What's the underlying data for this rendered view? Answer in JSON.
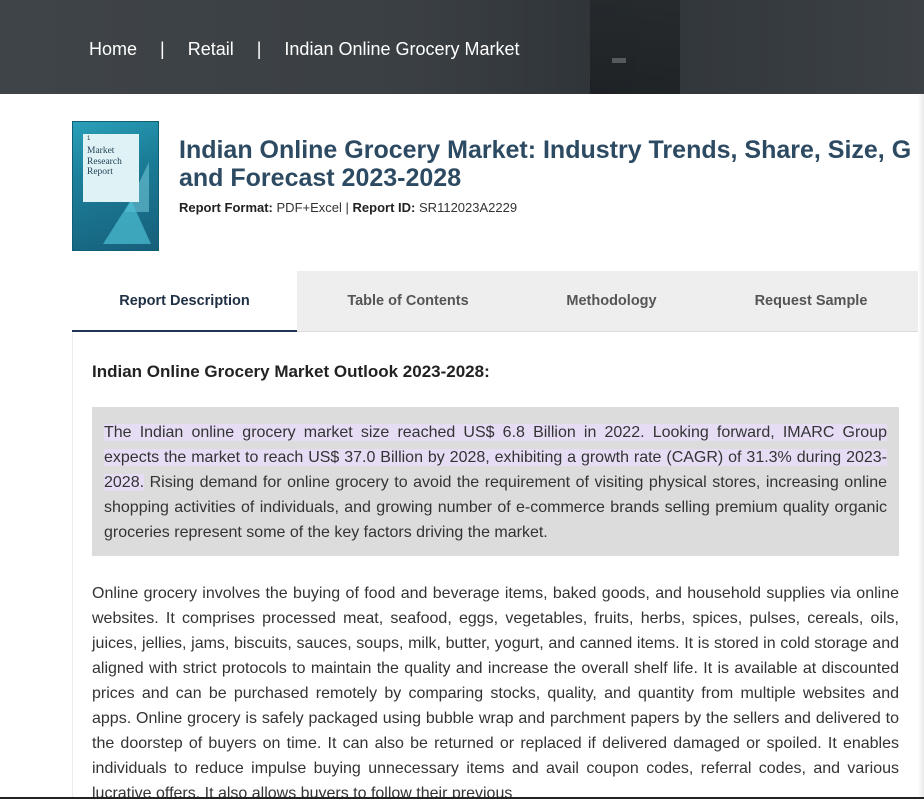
{
  "breadcrumb": {
    "items": [
      "Home",
      "Retail",
      "Indian Online Grocery Market"
    ],
    "separator": "|"
  },
  "cover": {
    "number": "1",
    "lines": [
      "Market",
      "Research",
      "Report"
    ]
  },
  "report": {
    "title_line1": "Indian Online Grocery Market: Industry Trends, Share, Size, G",
    "title_line2": "and Forecast 2023-2028",
    "format_label": "Report Format:",
    "format_value": "PDF+Excel",
    "meta_sep": "|",
    "id_label": "Report ID:",
    "id_value": "SR112023A2229"
  },
  "tabs": [
    {
      "label": "Report Description",
      "active": true
    },
    {
      "label": "Table of Contents",
      "active": false
    },
    {
      "label": "Methodology",
      "active": false
    },
    {
      "label": "Request Sample",
      "active": false
    }
  ],
  "content": {
    "heading": "Indian Online Grocery Market Outlook 2023-2028:",
    "summary_highlight": "The Indian online grocery market size reached US$ 6.8 Billion in 2022. Looking forward, IMARC Group expects the market to reach US$ 37.0 Billion by 2028, exhibiting a growth rate (CAGR) of 31.3% during 2023-2028.",
    "summary_rest": " Rising demand for online grocery to avoid the requirement of visiting physical stores, increasing online shopping activities of individuals, and growing number of e-commerce brands selling premium quality organic groceries represent some of the key factors driving the market.",
    "body": "Online grocery involves the buying of food and beverage items, baked goods, and household supplies via online websites. It comprises processed meat, seafood, eggs, vegetables, fruits, herbs, spices, pulses, cereals, oils, juices, jellies, jams, biscuits, sauces, soups, milk, butter, yogurt, and canned items. It is stored in cold storage and aligned with strict protocols to maintain the quality and increase the overall shelf life. It is available at discounted prices and can be purchased remotely by comparing stocks, quality, and quantity from multiple websites and apps. Online grocery is safely packaged using bubble wrap and parchment papers by the sellers and delivered to the doorstep of buyers on time. It can also be returned or replaced if delivered damaged or spoiled. It enables individuals to reduce impulse buying unnecessary items and avail coupon codes, referral codes, and various lucrative offers. It also allows buyers to follow their previous"
  },
  "colors": {
    "title": "#2d4a63",
    "active_tab_border": "#1f3553",
    "summary_bg": "#dcdcdc",
    "highlight": "#e6ddf5"
  }
}
